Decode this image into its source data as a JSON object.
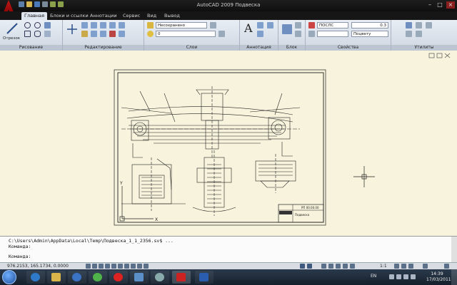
{
  "window": {
    "title": "AutoCAD 2009 Подвеска"
  },
  "ribbon": {
    "tabs": [
      "Главная",
      "Блоки и ссылки",
      "Аннотации",
      "Сервис",
      "Вид",
      "Вывод"
    ],
    "draw_panel": {
      "label": "Рисование",
      "polyline_label": "Отрезок"
    },
    "modify_panel": {
      "label": "Редактирование"
    },
    "layers_panel": {
      "label": "Слои",
      "layer_state": "Несохранено",
      "current_layer": "0"
    },
    "annotation_panel": {
      "label": "Аннотация"
    },
    "block_panel": {
      "label": "Блок"
    },
    "properties_panel": {
      "label": "Свойства",
      "color": "ПОСЛС",
      "lineweight": "0.3",
      "linetype": "Поцвету"
    },
    "utilities_panel": {
      "label": "Утилиты"
    }
  },
  "drawing": {
    "title_block_code": "РП 00.00.00",
    "title_block_name": "Подвеска"
  },
  "command": {
    "history_path": "C:\\Users\\Admin\\AppData\\Local\\Temp\\Подвеска_1_1_2356.sv$ ...",
    "history_prompt": "Команда:",
    "prompt": "Команда:"
  },
  "status": {
    "coords": "976.2153, 165.1734, 0.0000",
    "scale": "1:1"
  },
  "taskbar": {
    "lang": "EN",
    "time": "14:39",
    "date": "17/03/2011"
  },
  "colors": {
    "drawing_bg": "#f7f3dc",
    "ribbon_bg": "#dfe6ef",
    "taskbar_bg": "#1f2b38"
  }
}
